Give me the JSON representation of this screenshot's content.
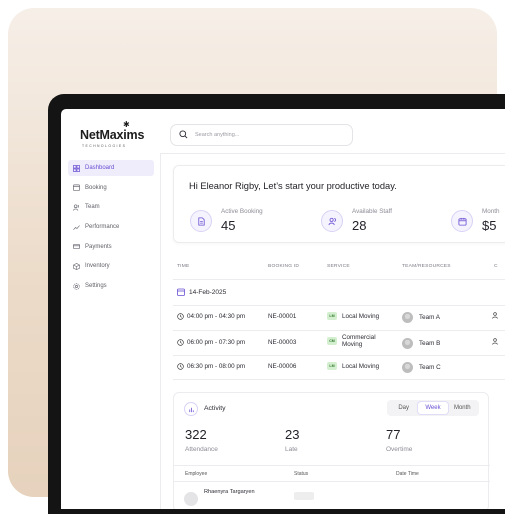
{
  "brand": {
    "name": "NetMaxims",
    "tagline": "TECHNOLOGIES"
  },
  "search": {
    "placeholder": "Search anything..."
  },
  "sidebar": {
    "items": [
      {
        "label": "Dashboard",
        "icon": "grid-icon",
        "active": true
      },
      {
        "label": "Booking",
        "icon": "calendar-icon"
      },
      {
        "label": "Team",
        "icon": "team-icon"
      },
      {
        "label": "Performance",
        "icon": "trend-icon"
      },
      {
        "label": "Payments",
        "icon": "card-icon"
      },
      {
        "label": "Inventory",
        "icon": "box-icon"
      },
      {
        "label": "Settings",
        "icon": "gear-icon"
      }
    ]
  },
  "greeting": "Hi Eleanor Rigby, Let’s start your productive today.",
  "stats": [
    {
      "label": "Active Booking",
      "value": "45",
      "icon": "document-icon"
    },
    {
      "label": "Available Staff",
      "value": "28",
      "icon": "staff-icon"
    },
    {
      "label": "Month",
      "value": "$5",
      "icon": "calendar-icon"
    }
  ],
  "table": {
    "columns": [
      "TIME",
      "BOOKING ID",
      "SERVICE",
      "TEAM/RESOURCES",
      "C"
    ],
    "date": "14-Feb-2025",
    "rows": [
      {
        "time": "04:00 pm - 04:30 pm",
        "booking_id": "NE-00001",
        "service_badge": "LM",
        "service": "Local Moving",
        "team": "Team A"
      },
      {
        "time": "06:00 pm - 07:30 pm",
        "booking_id": "NE-00003",
        "service_badge": "CM",
        "service": "Commercial\nMoving",
        "team": "Team B"
      },
      {
        "time": "06:30 pm - 08:00 pm",
        "booking_id": "NE-00006",
        "service_badge": "LM",
        "service": "Local Moving",
        "team": "Team C"
      }
    ]
  },
  "activity": {
    "title": "Activity",
    "tabs": [
      "Day",
      "Week",
      "Month"
    ],
    "active_tab": "Week",
    "metrics": [
      {
        "value": "322",
        "label": "Attendance"
      },
      {
        "value": "23",
        "label": "Late"
      },
      {
        "value": "77",
        "label": "Overtime"
      }
    ],
    "columns": [
      "Employee",
      "Status",
      "Date Time"
    ],
    "first_row_name": "Rhaenyra Targaryen"
  },
  "colors": {
    "accent": "#6a4fd3",
    "background_top": "#f6efe8",
    "background_bottom": "#e6d2bd",
    "device": "#141414"
  }
}
